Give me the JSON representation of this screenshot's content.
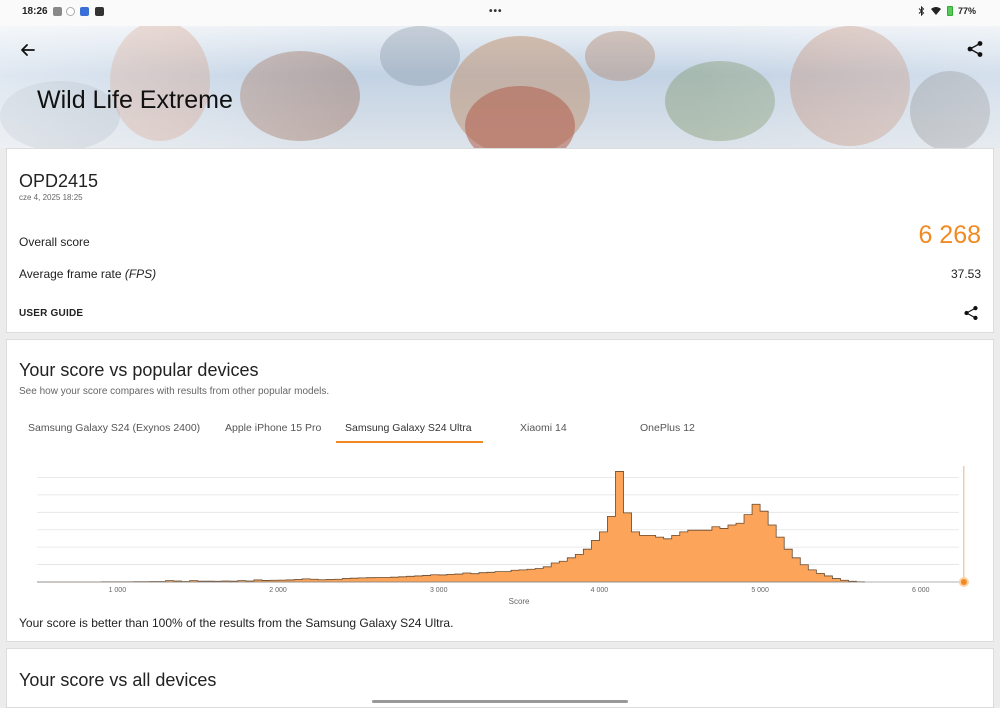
{
  "status_bar": {
    "time": "18:26",
    "battery": "77%",
    "colors": {
      "battery": "#44bb44"
    }
  },
  "header": {
    "title": "Wild Life Extreme",
    "back_icon": "arrow-left-icon",
    "share_icon": "share-icon"
  },
  "result_card": {
    "device": "OPD2415",
    "date": "cze 4, 2025 18:25",
    "overall_label": "Overall score",
    "overall_value": "6 268",
    "fps_label": "Average frame rate",
    "fps_unit": "(FPS)",
    "fps_value": "37.53",
    "user_guide": "USER GUIDE",
    "share_icon": "share-icon",
    "colors": {
      "accent": "#f28a22"
    }
  },
  "comparison": {
    "title": "Your score vs popular devices",
    "subtitle": "See how your score compares with results from other popular models.",
    "tabs": [
      {
        "label": "Samsung Galaxy S24 (Exynos 2400)",
        "active": false
      },
      {
        "label": "Apple iPhone 15 Pro",
        "active": false
      },
      {
        "label": "Samsung Galaxy S24 Ultra",
        "active": true
      },
      {
        "label": "Xiaomi 14",
        "active": false
      },
      {
        "label": "OnePlus 12",
        "active": false
      }
    ],
    "result_text": "Your score is better than 100% of the results from the Samsung Galaxy S24 Ultra."
  },
  "chart_data": {
    "type": "area",
    "xlabel": "Score",
    "ylabel": "",
    "xlim": [
      500,
      6300
    ],
    "x_ticks": [
      1000,
      2000,
      3000,
      4000,
      5000,
      6000
    ],
    "x_tick_labels": [
      "1 000",
      "2 000",
      "3 000",
      "4 000",
      "5 000",
      "6 000"
    ],
    "grid": true,
    "marker_score": 6268,
    "series": [
      {
        "x": [
          500,
          550,
          600,
          650,
          700,
          750,
          800,
          850,
          900,
          950,
          1000,
          1050,
          1100,
          1150,
          1200,
          1250,
          1300,
          1350,
          1400,
          1450,
          1500,
          1550,
          1600,
          1650,
          1700,
          1750,
          1800,
          1850,
          1900,
          1950,
          2000,
          2050,
          2100,
          2150,
          2200,
          2250,
          2300,
          2350,
          2400,
          2450,
          2500,
          2550,
          2600,
          2650,
          2700,
          2750,
          2800,
          2850,
          2900,
          2950,
          3000,
          3050,
          3100,
          3150,
          3200,
          3250,
          3300,
          3350,
          3400,
          3450,
          3500,
          3550,
          3600,
          3650,
          3700,
          3750,
          3800,
          3850,
          3900,
          3950,
          4000,
          4050,
          4100,
          4150,
          4200,
          4250,
          4300,
          4350,
          4400,
          4450,
          4500,
          4550,
          4600,
          4650,
          4700,
          4750,
          4800,
          4850,
          4900,
          4950,
          5000,
          5050,
          5100,
          5150,
          5200,
          5250,
          5300,
          5350,
          5400,
          5450,
          5500,
          5550,
          5600
        ],
        "values": [
          0,
          0,
          0,
          0,
          0,
          0,
          0,
          0,
          0.1,
          0.1,
          0.1,
          0.1,
          0.2,
          0.2,
          0.3,
          0.3,
          0.8,
          0.6,
          0.3,
          0.8,
          0.5,
          0.5,
          0.4,
          0.6,
          0.5,
          0.8,
          0.6,
          1.2,
          0.9,
          1.0,
          1.1,
          1.2,
          1.4,
          1.8,
          1.6,
          1.3,
          1.4,
          1.6,
          2.0,
          2.2,
          2.4,
          2.5,
          2.6,
          2.6,
          2.8,
          3.0,
          3.3,
          3.5,
          3.8,
          4.2,
          4.1,
          4.4,
          4.6,
          5.2,
          4.8,
          5.4,
          5.6,
          6.0,
          6.0,
          6.8,
          7.0,
          7.4,
          7.8,
          8.8,
          11.0,
          12.0,
          14.0,
          16.0,
          19.0,
          24.0,
          29.0,
          38.0,
          64.0,
          40.0,
          29.0,
          27.0,
          27.0,
          26.0,
          25.0,
          27.0,
          29.0,
          30.0,
          30.0,
          30.0,
          32.0,
          31.0,
          33.0,
          34.0,
          39.0,
          45.0,
          41.0,
          33.0,
          26.0,
          19.0,
          14.0,
          10.0,
          7.0,
          5.0,
          3.5,
          2.0,
          1.0,
          0.4,
          0.1
        ]
      }
    ],
    "colors": {
      "fill": "#fba45a",
      "stroke": "#6a4a2c",
      "marker": "#f28a22"
    }
  }
}
